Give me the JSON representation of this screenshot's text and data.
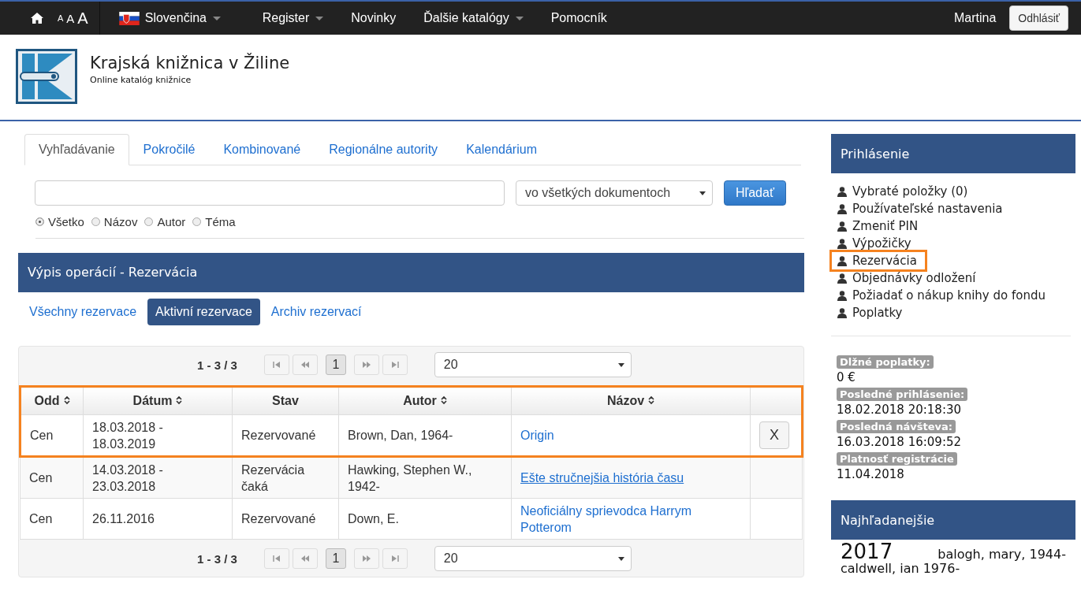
{
  "navbar": {
    "font_sizes": [
      "A",
      "A",
      "A"
    ],
    "language": "Slovenčina",
    "menu": [
      {
        "label": "Register",
        "dropdown": true
      },
      {
        "label": "Novinky",
        "dropdown": false
      },
      {
        "label": "Ďalšie katalógy",
        "dropdown": true
      },
      {
        "label": "Pomocník",
        "dropdown": false
      }
    ],
    "user": "Martina",
    "logout": "Odhlásiť"
  },
  "header": {
    "title": "Krajská knižnica v Žiline",
    "subtitle": "Online katalóg knižnice"
  },
  "search": {
    "tabs": [
      {
        "label": "Vyhľadávanie",
        "selected": true
      },
      {
        "label": "Pokročilé",
        "selected": false
      },
      {
        "label": "Kombinované",
        "selected": false
      },
      {
        "label": "Regionálne autority",
        "selected": false
      },
      {
        "label": "Kalendárium",
        "selected": false
      }
    ],
    "scope": "vo všetkých dokumentoch",
    "button": "Hľadať",
    "radios": [
      {
        "label": "Všetko",
        "selected": true
      },
      {
        "label": "Názov",
        "selected": false
      },
      {
        "label": "Autor",
        "selected": false
      },
      {
        "label": "Téma",
        "selected": false
      }
    ]
  },
  "panel_title": "Výpis operácií - Rezervácia",
  "filters": [
    {
      "label": "Všechny rezervace",
      "selected": false
    },
    {
      "label": "Aktivní rezervace",
      "selected": true
    },
    {
      "label": "Archiv rezervací",
      "selected": false
    }
  ],
  "pagers": [
    {
      "range": "1 - 3 / 3",
      "page": "1",
      "per_page": "20"
    },
    {
      "range": "1 - 3 / 3",
      "page": "1",
      "per_page": "20"
    }
  ],
  "table": {
    "header_highlighted": true,
    "columns": [
      {
        "label": "Odd",
        "sortable": true
      },
      {
        "label": "Dátum",
        "sortable": true
      },
      {
        "label": "Stav",
        "sortable": false
      },
      {
        "label": "Autor",
        "sortable": true
      },
      {
        "label": "Názov",
        "sortable": true
      }
    ],
    "rows": [
      {
        "odd": "Cen",
        "date": [
          "18.03.2018 -",
          "18.03.2019"
        ],
        "status": "Rezervované",
        "author": "Brown, Dan, 1964-",
        "title": "Origin",
        "underlined": false,
        "cancel": "X",
        "highlighted": true
      },
      {
        "odd": "Cen",
        "date": [
          "14.03.2018 -",
          "23.03.2018"
        ],
        "status": "Rezervácia čaká",
        "author": "Hawking, Stephen W., 1942-",
        "title": "Ešte stručnejšia história času",
        "underlined": true,
        "highlighted": false
      },
      {
        "odd": "Cen",
        "date": [
          "26.11.2016"
        ],
        "status": "Rezervované",
        "author": "Down, E.",
        "title": "Neoficiálny sprievodca Harrym Potterom",
        "underlined": false,
        "highlighted": false
      }
    ]
  },
  "login": {
    "title": "Prihlásenie",
    "items": [
      {
        "label": "Vybraté položky (0)",
        "highlighted": false
      },
      {
        "label": "Používateľské nastavenia",
        "highlighted": false
      },
      {
        "label": "Zmeniť PIN",
        "highlighted": false
      },
      {
        "label": "Výpožičky",
        "highlighted": false
      },
      {
        "label": "Rezervácia",
        "highlighted": true
      },
      {
        "label": "Objednávky odložení",
        "highlighted": false
      },
      {
        "label": "Požiadať o nákup knihy do fondu",
        "highlighted": false
      },
      {
        "label": "Poplatky",
        "highlighted": false
      }
    ],
    "info": [
      {
        "label": "Dlžné poplatky:",
        "value": "0 €"
      },
      {
        "label": "Posledné prihlásenie:",
        "value": "18.02.2018 20:18:30"
      },
      {
        "label": "Posledná návšteva:",
        "value": "16.03.2018 16:09:52"
      },
      {
        "label": "Platnosť registrácie",
        "value": "11.04.2018"
      }
    ]
  },
  "popular": {
    "title": "Najhľadanejšie",
    "terms": [
      {
        "text": "2017",
        "kind": "large"
      },
      {
        "text": "balogh, mary, 1944-",
        "kind": "normal"
      },
      {
        "text": "caldwell, ian 1976-",
        "kind": "normal"
      }
    ]
  }
}
